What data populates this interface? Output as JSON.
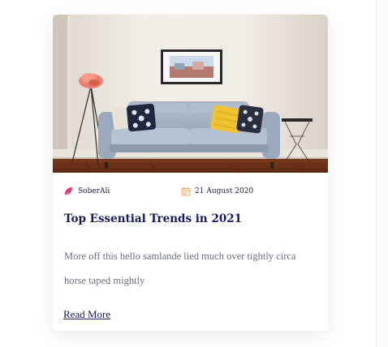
{
  "post": {
    "author": "SoberAli",
    "date": "21 August 2020",
    "title": "Top Essential Trends in 2021",
    "excerpt": "More off this hello samlande lied much over tightly circa horse taped mightly",
    "read_more_label": "Read More"
  },
  "icons": {
    "author": "feather-pen-icon",
    "date": "calendar-icon"
  },
  "colors": {
    "title": "#161a5c",
    "body_text": "#6a6f85",
    "author_icon": "#e8317a",
    "date_icon": "#f3a35a"
  }
}
